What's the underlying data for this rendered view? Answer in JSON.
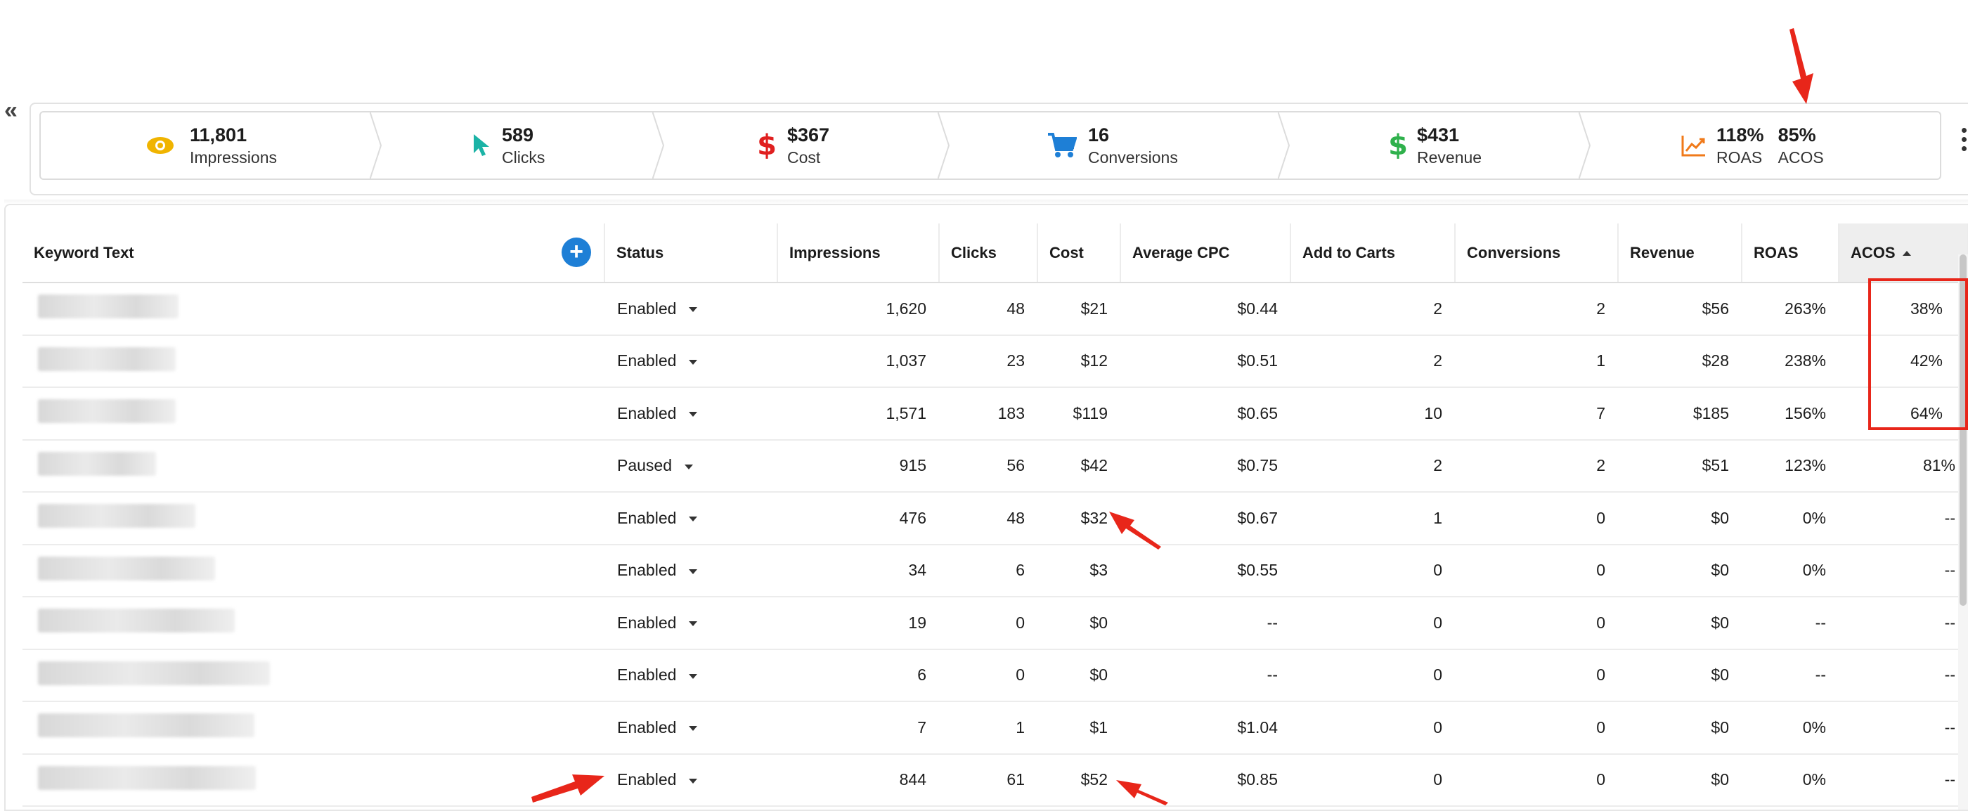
{
  "collapse_glyph": "«",
  "summary": [
    {
      "icon": "eye-icon",
      "value": "11,801",
      "label": "Impressions",
      "color": "#f0b400"
    },
    {
      "icon": "cursor-icon",
      "value": "589",
      "label": "Clicks",
      "color": "#1bb3a6"
    },
    {
      "icon": "dollar-icon",
      "value": "$367",
      "label": "Cost",
      "color": "#e02020"
    },
    {
      "icon": "cart-icon",
      "value": "16",
      "label": "Conversions",
      "color": "#1e7fd6"
    },
    {
      "icon": "dollar-icon",
      "value": "$431",
      "label": "Revenue",
      "color": "#2fb14c"
    },
    {
      "icon": "trend-chart-icon",
      "value": "118%",
      "label": "ROAS",
      "value2": "85%",
      "label2": "ACOS",
      "color": "#f07a1a"
    }
  ],
  "table": {
    "headers": [
      "Keyword Text",
      "Status",
      "Impressions",
      "Clicks",
      "Cost",
      "Average CPC",
      "Add to Carts",
      "Conversions",
      "Revenue",
      "ROAS",
      "ACOS"
    ],
    "rows": [
      {
        "status": "Enabled",
        "impressions": "1,620",
        "clicks": "48",
        "cost": "$21",
        "cpc": "$0.44",
        "atc": "2",
        "conv": "2",
        "revenue": "$56",
        "roas": "263%",
        "acos": "38%"
      },
      {
        "status": "Enabled",
        "impressions": "1,037",
        "clicks": "23",
        "cost": "$12",
        "cpc": "$0.51",
        "atc": "2",
        "conv": "1",
        "revenue": "$28",
        "roas": "238%",
        "acos": "42%"
      },
      {
        "status": "Enabled",
        "impressions": "1,571",
        "clicks": "183",
        "cost": "$119",
        "cpc": "$0.65",
        "atc": "10",
        "conv": "7",
        "revenue": "$185",
        "roas": "156%",
        "acos": "64%"
      },
      {
        "status": "Paused",
        "impressions": "915",
        "clicks": "56",
        "cost": "$42",
        "cpc": "$0.75",
        "atc": "2",
        "conv": "2",
        "revenue": "$51",
        "roas": "123%",
        "acos": "81%"
      },
      {
        "status": "Enabled",
        "impressions": "476",
        "clicks": "48",
        "cost": "$32",
        "cpc": "$0.67",
        "atc": "1",
        "conv": "0",
        "revenue": "$0",
        "roas": "0%",
        "acos": "--"
      },
      {
        "status": "Enabled",
        "impressions": "34",
        "clicks": "6",
        "cost": "$3",
        "cpc": "$0.55",
        "atc": "0",
        "conv": "0",
        "revenue": "$0",
        "roas": "0%",
        "acos": "--"
      },
      {
        "status": "Enabled",
        "impressions": "19",
        "clicks": "0",
        "cost": "$0",
        "cpc": "--",
        "atc": "0",
        "conv": "0",
        "revenue": "$0",
        "roas": "--",
        "acos": "--"
      },
      {
        "status": "Enabled",
        "impressions": "6",
        "clicks": "0",
        "cost": "$0",
        "cpc": "--",
        "atc": "0",
        "conv": "0",
        "revenue": "$0",
        "roas": "--",
        "acos": "--"
      },
      {
        "status": "Enabled",
        "impressions": "7",
        "clicks": "1",
        "cost": "$1",
        "cpc": "$1.04",
        "atc": "0",
        "conv": "0",
        "revenue": "$0",
        "roas": "0%",
        "acos": "--"
      },
      {
        "status": "Enabled",
        "impressions": "844",
        "clicks": "61",
        "cost": "$52",
        "cpc": "$0.85",
        "atc": "0",
        "conv": "0",
        "revenue": "$0",
        "roas": "0%",
        "acos": "--"
      }
    ]
  },
  "colors": {
    "annotation": "#e8261a",
    "add_button": "#1e7fd6"
  }
}
